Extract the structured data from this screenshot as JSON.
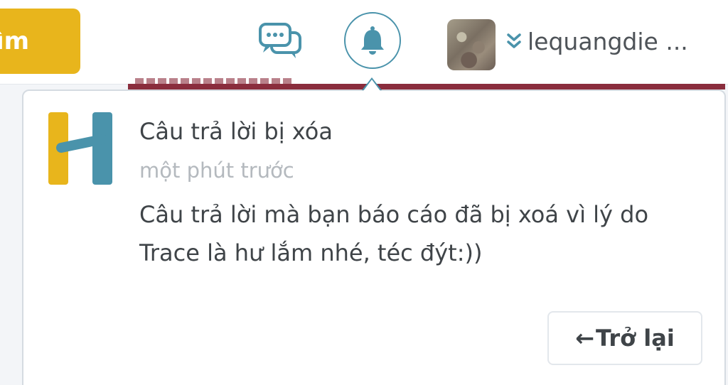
{
  "header": {
    "search_button_label": "ìm",
    "username": "lequangdie ..."
  },
  "notification": {
    "title": "Câu trả lời bị xóa",
    "time": "một phút trước",
    "body": "Câu trả lời mà bạn báo cáo đã bị xoá vì lý do Trace là hư lắm nhé, téc đýt:))",
    "back_arrow": "←",
    "back_label": "Trở lại"
  },
  "icons": {
    "chat": "chat-bubbles-icon",
    "bell": "bell-icon",
    "menu": "double-chevron-down-icon",
    "logo": "hoc24-logo"
  },
  "colors": {
    "accent": "#4a93ab",
    "brand_yellow": "#e8b51c",
    "text": "#3f4448",
    "muted": "#b4b9be"
  }
}
